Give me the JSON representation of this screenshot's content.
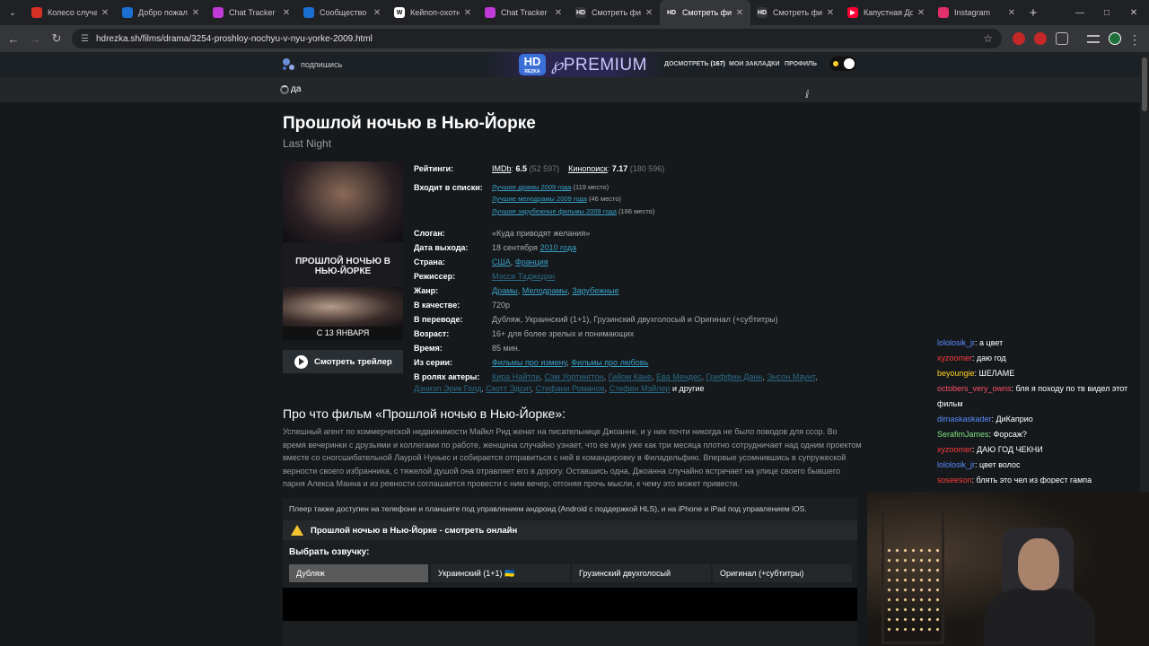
{
  "browser": {
    "tabs": [
      {
        "title": "Колесо случай",
        "fav": "#d93025",
        "favtext": ""
      },
      {
        "title": "Добро пожало",
        "fav": "#1b6fd1",
        "favtext": ""
      },
      {
        "title": "Chat Tracker",
        "fav": "#c03ad8",
        "favtext": ""
      },
      {
        "title": "Сообщество S",
        "fav": "#1b6fd1",
        "favtext": ""
      },
      {
        "title": "Кейпоп-охотн",
        "fav": "#ffffff",
        "favtext": "W"
      },
      {
        "title": "Chat Tracker",
        "fav": "#c03ad8",
        "favtext": ""
      },
      {
        "title": "Смотреть фил",
        "fav": "#35363a",
        "favtext": "HD"
      },
      {
        "title": "Смотреть фил",
        "fav": "#35363a",
        "favtext": "HD",
        "active": true
      },
      {
        "title": "Смотреть фил",
        "fav": "#35363a",
        "favtext": "HD"
      },
      {
        "title": "Капустная Дол",
        "fav": "#ff0033",
        "favtext": "▶"
      },
      {
        "title": "Instagram",
        "fav": "#e1306c",
        "favtext": ""
      }
    ],
    "url": "hdrezka.sh/films/drama/3254-proshloy-nochyu-v-nyu-yorke-2009.html"
  },
  "header": {
    "subscribe": "подпишись",
    "logo_hd": "HD",
    "logo_sub": "REZKA",
    "premium": "PREMIUM",
    "watch_later": "ДОСМОТРЕТЬ",
    "watch_later_count": "(167)",
    "bookmarks": "МОИ ЗАКЛАДКИ",
    "profile": "ПРОФИЛЬ"
  },
  "search": {
    "query": "да"
  },
  "film": {
    "title": "Прошлой ночью в Нью-Йорке",
    "original": "Last Night",
    "poster_text": "ПРОШЛОЙ НОЧЬЮ В НЬЮ-ЙОРКЕ",
    "poster_date": "С 13 ЯНВАРЯ",
    "trailer": "Смотреть трейлер",
    "labels": {
      "ratings": "Рейтинги:",
      "lists": "Входит в списки:",
      "slogan": "Слоган:",
      "release": "Дата выхода:",
      "country": "Страна:",
      "director": "Режиссер:",
      "genre": "Жанр:",
      "quality": "В качестве:",
      "translation": "В переводе:",
      "age": "Возраст:",
      "time": "Время:",
      "series": "Из серии:",
      "actors": "В ролях актеры:"
    },
    "imdb_label": "IMDb",
    "imdb": "6.5",
    "imdb_votes": "(52 597)",
    "kp_label": "Кинопоиск",
    "kp": "7.17",
    "kp_votes": "(180 596)",
    "lists": [
      {
        "name": "Лучшие драмы 2009 года",
        "place": "(119 место)"
      },
      {
        "name": "Лучшие мелодрамы 2009 года",
        "place": "(46 место)"
      },
      {
        "name": "Лучшие зарубежные фильмы 2009 года",
        "place": "(166 место)"
      }
    ],
    "slogan": "«Куда приводят желания»",
    "release_date": "18 сентября",
    "release_year": "2010 года",
    "country1": "США",
    "country2": "Франция",
    "director": "Мэсси Таджедин",
    "genre1": "Драмы",
    "genre2": "Мелодрамы",
    "genre3": "Зарубежные",
    "quality": "720p",
    "translation": "Дубляж, Украинский (1+1), Грузинский двухголосый и Оригинал (+субтитры)",
    "age_num": "16+",
    "age_text": " для более зрелых и понимающих",
    "time": "85 мин.",
    "series1": "Фильмы про измену",
    "series2": "Фильмы про любовь",
    "actors_line1": [
      "Кира Найтли",
      "Сэм Уортингтон",
      "Гийом Кане",
      "Ева Мендес",
      "Гриффин Данн",
      "Энсон Маунт"
    ],
    "actors_line2": [
      "Дэниэл Эрик Голд",
      "Скотт Эдсит",
      "Стефани Романов",
      "Стефен Мэйлер"
    ],
    "actors_more": "и другие",
    "about_title": "Про что фильм «Прошлой ночью в Нью-Йорке»:",
    "description": "Успешный агент по коммерческой недвижимости Майкл Рид женат на писательнице Джоанне, и у них почти никогда не было поводов для ссор. Во время вечеринки с друзьями и коллегами по работе, женщина случайно узнает, что ее муж уже как три месяца плотно сотрудничает над одним проектом вместе со сногсшибательной Лаурой Нуньес и собирается отправиться с ней в командировку в Филадельфию. Впервые усомнившись в супружеской верности своего избранника, с тяжелой душой она отравляет его в дорогу. Оставшись одна, Джоанна случайно встречает на улице своего бывшего парня Алекса Манна и из ревности соглашается провести с ним вечер, отгоняя прочь мысли, к чему это может привести."
  },
  "player": {
    "note": "Плеер также доступен на телефоне и планшете под управлением андроид (Android с поддержкой HLS), и на iPhone и iPad под управлением iOS.",
    "title": "Прошлой ночью в Нью-Йорке - смотреть онлайн",
    "voice_label": "Выбрать озвучку:",
    "voices": [
      "Дубляж",
      "Украинский (1+1) 🇺🇦",
      "Грузинский двухголосый",
      "Оригинал (+субтитры)"
    ]
  },
  "chat": [
    {
      "user": "lololosik_jr",
      "color": "#5b8cff",
      "text": ": а цвет"
    },
    {
      "user": "xyzoomer",
      "color": "#ff3b3b",
      "text": ": даю год"
    },
    {
      "user": "beyoungie",
      "color": "#ffd21f",
      "text": ": ШЕЛАМЕ"
    },
    {
      "user": "octobers_very_owns",
      "color": "#ff4d6d",
      "text": ": бля я походу по тв видел этот"
    },
    {
      "user": "",
      "color": "#fff",
      "text": "фильм"
    },
    {
      "user": "dimaskaskader",
      "color": "#5b8cff",
      "text": ": ДиКаприо"
    },
    {
      "user": "SerafimJames",
      "color": "#7ee07e",
      "text": ": Форсаж?"
    },
    {
      "user": "xyzoomer",
      "color": "#ff3b3b",
      "text": ": ДАЮ ГОД ЧЕКНИ"
    },
    {
      "user": "lololosik_jr",
      "color": "#5b8cff",
      "text": ": цвет волос"
    },
    {
      "user": "soseeson",
      "color": "#ff3b3b",
      "text": ": блять это чел из форест гампа"
    }
  ]
}
